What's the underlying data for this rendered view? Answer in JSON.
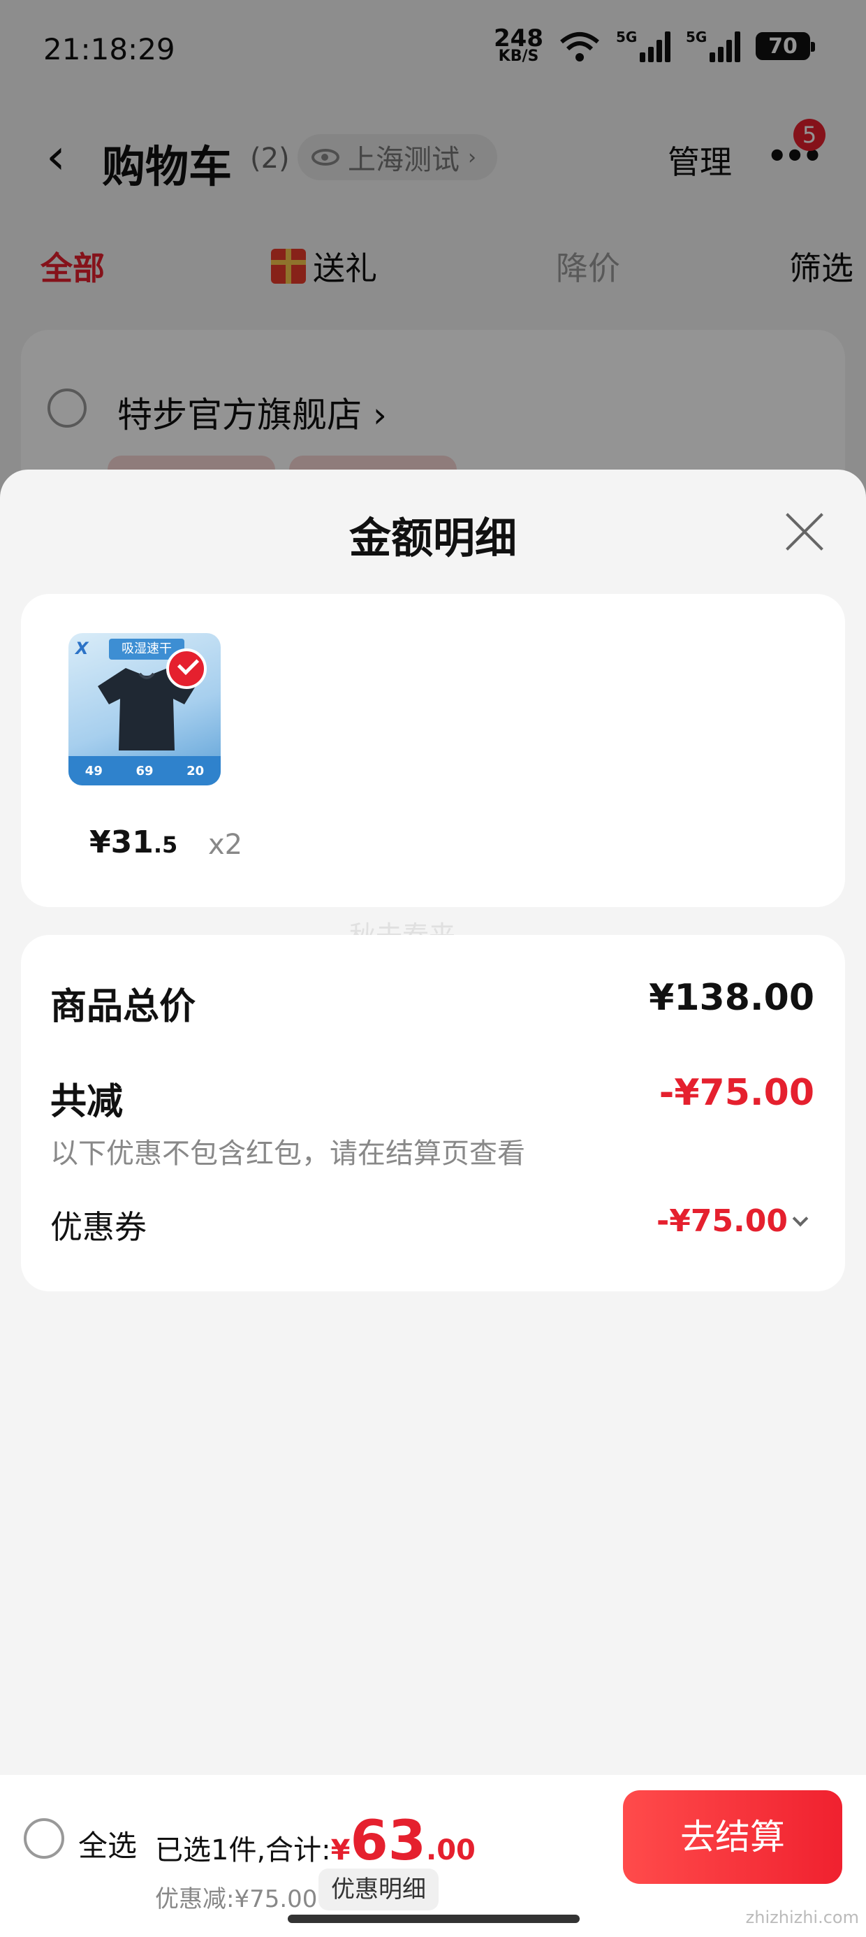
{
  "status_bar": {
    "time": "21:18:29",
    "net_speed_value": "248",
    "net_speed_unit": "KB/S",
    "sim1_label": "5G",
    "sim2_label": "5G",
    "battery": "70"
  },
  "nav": {
    "title": "购物车",
    "count": "(2)",
    "location": "上海测试",
    "manage": "管理",
    "more_badge": "5"
  },
  "tabs": [
    {
      "label": "全部"
    },
    {
      "label": "送礼"
    },
    {
      "label": "降价"
    },
    {
      "label": "筛选"
    }
  ],
  "shop": {
    "name": "特步官方旗舰店"
  },
  "sheet": {
    "title": "金额明细",
    "item": {
      "img_banner": "吸湿速干",
      "img_stats": [
        "49",
        "69",
        "20"
      ],
      "price_int": "¥31",
      "price_dec": ".5",
      "qty": "x2"
    },
    "watermark": "秋去春来",
    "summary": {
      "total_label": "商品总价",
      "total_value": "¥138.00",
      "minus_label": "共减",
      "minus_value": "-¥75.00",
      "minus_note": "以下优惠不包含红包，请在结算页查看",
      "coupon_label": "优惠券",
      "coupon_value": "-¥75.00"
    }
  },
  "bottom": {
    "select_all": "全选",
    "selected_text": "已选1件,合计:",
    "amount_symbol": "¥",
    "amount_int": "63",
    "amount_dec": ".00",
    "discount_text": "优惠减:¥75.00",
    "detail_button": "优惠明细",
    "checkout_button": "去结算",
    "corner_logo": "zhizhizhi.com"
  },
  "colors": {
    "accent_red": "#e5202e",
    "sheet_bg": "#f4f4f4"
  }
}
